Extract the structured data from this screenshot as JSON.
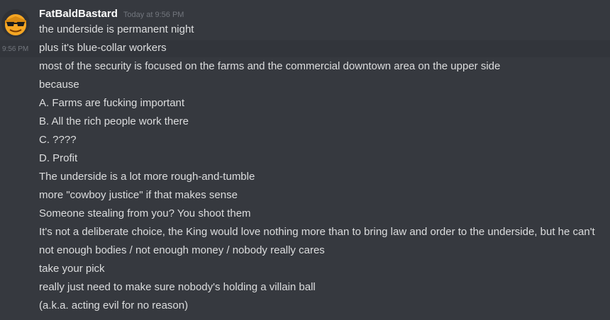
{
  "message": {
    "author": "FatBaldBastard",
    "timestamp": "Today at 9:56 PM",
    "hover_time": "9:56 PM",
    "avatar_icon": "sunglasses-emoji-face-icon",
    "colors": {
      "background": "#36393f",
      "hover_row": "#32353b",
      "username": "#ffffff",
      "text": "#dcddde",
      "muted": "#72767d",
      "avatar_bg": "#f5a623"
    },
    "lines": [
      "the underside is permanent night",
      "plus it's blue-collar workers",
      "most of the security is focused on the farms and the commercial downtown area on the upper side",
      "because",
      "A. Farms are fucking important",
      "B. All the rich people work there",
      "C. ????",
      "D. Profit",
      "The underside is a lot more rough-and-tumble",
      "more \"cowboy justice\" if that makes sense",
      "Someone stealing from you? You shoot them",
      "It's not a deliberate choice, the King would love nothing more than to bring law and order to the underside, but he can't",
      "not enough bodies / not enough money / nobody really cares",
      "take your pick",
      "really just need to make sure nobody's holding a villain ball",
      "(a.k.a. acting evil for no reason)"
    ]
  }
}
